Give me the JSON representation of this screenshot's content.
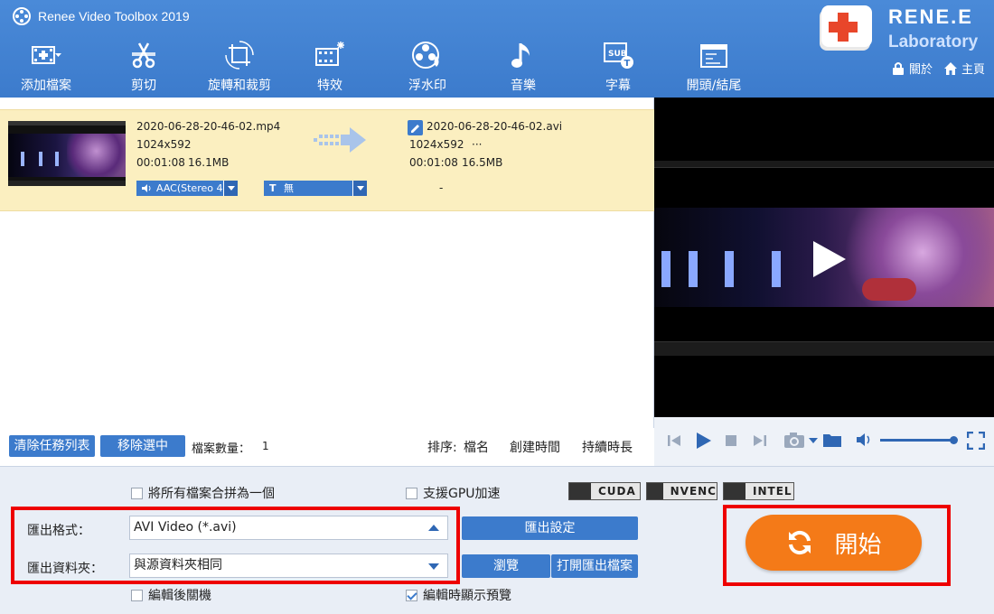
{
  "app": {
    "title": "Renee Video Toolbox 2019"
  },
  "brand": {
    "name": "RENE.E",
    "sub": "Laboratory"
  },
  "toolbar": [
    {
      "label": "添加檔案",
      "icon": "add-file-icon"
    },
    {
      "label": "剪切",
      "icon": "cut-icon"
    },
    {
      "label": "旋轉和裁剪",
      "icon": "rotate-crop-icon"
    },
    {
      "label": "特效",
      "icon": "effects-icon"
    },
    {
      "label": "浮水印",
      "icon": "watermark-icon"
    },
    {
      "label": "音樂",
      "icon": "music-icon"
    },
    {
      "label": "字幕",
      "icon": "subtitle-icon"
    },
    {
      "label": "開頭/結尾",
      "icon": "intro-outro-icon"
    }
  ],
  "top_links": {
    "about": "關於",
    "home": "主頁"
  },
  "file": {
    "source_name": "2020-06-28-20-46-02.mp4",
    "source_res": "1024x592",
    "source_duration": "00:01:08",
    "source_size": "16.1MB",
    "output_name": "2020-06-28-20-46-02.avi",
    "output_res": "1024x592",
    "output_more": "···",
    "output_duration": "00:01:08",
    "output_size": "16.5MB",
    "audio_track": "AAC(Stereo 4",
    "subtitle_track": "無",
    "subtitle_prefix": "T",
    "output_track": "-"
  },
  "list_bar": {
    "clear_label": "清除任務列表",
    "remove_label": "移除選中",
    "count_label": "檔案數量：",
    "count_value": "1",
    "sort_label": "排序:",
    "sort_name": "檔名",
    "sort_created": "創建時間",
    "sort_duration": "持續時長"
  },
  "options": {
    "merge_label": "將所有檔案合拼為一個",
    "merge_checked": false,
    "gpu_label": "支援GPU加速",
    "gpu_checked": false,
    "badges": [
      "CUDA",
      "NVENC",
      "INTEL"
    ],
    "shutdown_label": "編輯後關機",
    "shutdown_checked": false,
    "preview_label": "編輯時顯示預覽",
    "preview_checked": true
  },
  "export": {
    "format_label": "匯出格式：",
    "format_value": "AVI Video (*.avi)",
    "folder_label": "匯出資料夾：",
    "folder_value": "與源資料夾相同",
    "settings_label": "匯出設定",
    "browse_label": "瀏覽",
    "open_folder_label": "打開匯出檔案"
  },
  "start": {
    "label": "開始"
  },
  "colors": {
    "header": "#3c7bcc",
    "accent": "#f47a18",
    "highlight": "#fbefc0",
    "frame": "#ee0000"
  }
}
